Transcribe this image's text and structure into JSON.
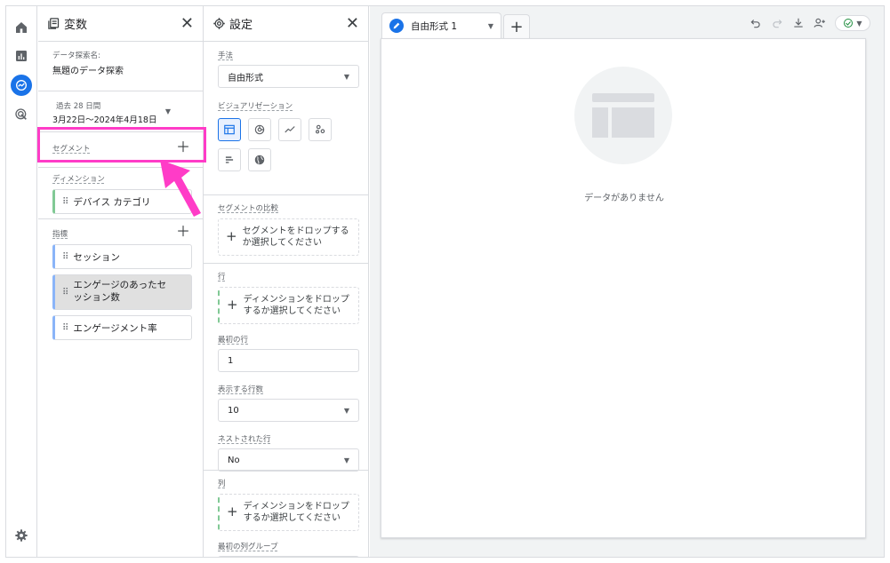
{
  "rail": {
    "items": [
      "home-icon",
      "reports-icon",
      "explore-icon",
      "advertising-icon"
    ],
    "settings": "gear-icon"
  },
  "variables": {
    "title": "変数",
    "exploration_name_label": "データ探索名:",
    "exploration_name": "無題のデータ探索",
    "date_range_label": "過去 28 日間",
    "date_range_value": "3月22日～2024年4月18日",
    "segments_label": "セグメント",
    "dimensions_label": "ディメンション",
    "dimensions": [
      "デバイス カテゴリ"
    ],
    "metrics_label": "指標",
    "metrics": [
      "セッション",
      "エンゲージのあったセッション数",
      "エンゲージメント率"
    ]
  },
  "settings": {
    "title": "設定",
    "technique_label": "手法",
    "technique_value": "自由形式",
    "viz_label": "ビジュアリゼーション",
    "segment_compare_label": "セグメントの比較",
    "segment_drop": "セグメントをドロップするか選択してください",
    "rows_label": "行",
    "rows_drop": "ディメンションをドロップするか選択してください",
    "first_row_label": "最初の行",
    "first_row_value": "1",
    "show_rows_label": "表示する行数",
    "show_rows_value": "10",
    "nested_rows_label": "ネストされた行",
    "nested_rows_value": "No",
    "columns_label": "列",
    "columns_drop": "ディメンションをドロップするか選択してください",
    "first_col_group_label": "最初の列グループ"
  },
  "canvas": {
    "tab_label": "自由形式 1",
    "empty_text": "データがありません"
  },
  "colors": {
    "accent": "#1a73e8",
    "highlight": "#ff3cc7"
  }
}
